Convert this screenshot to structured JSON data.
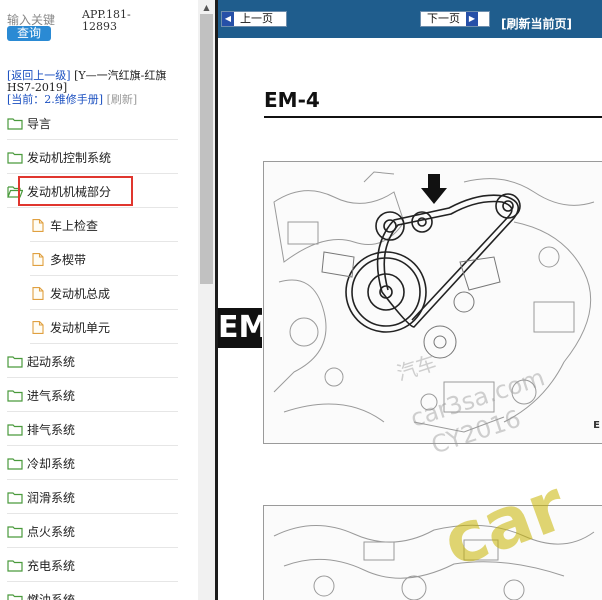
{
  "search": {
    "label": "输入关键",
    "button_label": "查询",
    "app_code": "APP.181-12893"
  },
  "nav": {
    "back_link": "[返回上一级]",
    "breadcrumb": "[Y—一汽红旗-红旗HS7-2019]",
    "current_prefix": "[当前：",
    "current_value": "2.维修手册]",
    "refresh": "[刷新]"
  },
  "tree": {
    "items": [
      {
        "label": "导言",
        "type": "folder"
      },
      {
        "label": "发动机控制系统",
        "type": "folder"
      },
      {
        "label": "发动机机械部分",
        "type": "folder-open"
      },
      {
        "label": "车上检查",
        "type": "page"
      },
      {
        "label": "多楔带",
        "type": "page"
      },
      {
        "label": "发动机总成",
        "type": "page"
      },
      {
        "label": "发动机单元",
        "type": "page"
      },
      {
        "label": "起动系统",
        "type": "folder"
      },
      {
        "label": "进气系统",
        "type": "folder"
      },
      {
        "label": "排气系统",
        "type": "folder"
      },
      {
        "label": "冷却系统",
        "type": "folder"
      },
      {
        "label": "润滑系统",
        "type": "folder"
      },
      {
        "label": "点火系统",
        "type": "folder"
      },
      {
        "label": "充电系统",
        "type": "folder"
      },
      {
        "label": "燃油系统",
        "type": "folder"
      }
    ]
  },
  "toolbar": {
    "prev_label": "上一页",
    "next_label": "下一页",
    "refresh_label": "[刷新当前页]"
  },
  "document": {
    "page_code": "EM-4",
    "section_tab": "EM",
    "figure_code": "E",
    "watermark_1": "汽车",
    "watermark_2": "car3sa.com",
    "watermark_3": "CY2016"
  },
  "colors": {
    "topbar": "#1f5d8d",
    "query_button": "#2a8ad4",
    "highlight_border": "#e0362e",
    "link": "#1a4fc0"
  }
}
